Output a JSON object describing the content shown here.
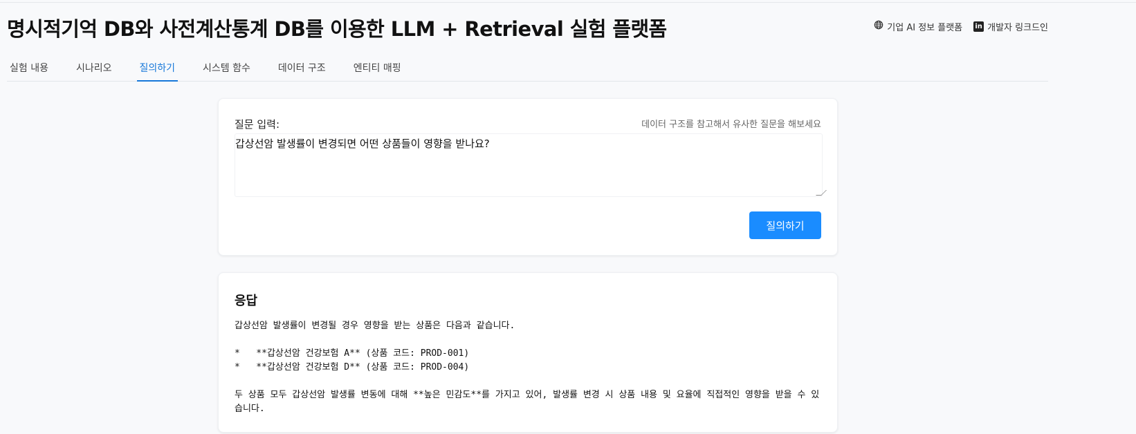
{
  "header": {
    "title": "명시적기억 DB와 사전계산통계 DB를 이용한 LLM + Retrieval 실험 플랫폼",
    "links": [
      {
        "label": "기업 AI 정보 플랫폼",
        "icon": "globe-icon"
      },
      {
        "label": "개발자 링크드인",
        "icon": "linkedin-icon"
      }
    ]
  },
  "tabs": [
    {
      "label": "실험 내용",
      "active": false
    },
    {
      "label": "시나리오",
      "active": false
    },
    {
      "label": "질의하기",
      "active": true
    },
    {
      "label": "시스템 함수",
      "active": false
    },
    {
      "label": "데이터 구조",
      "active": false
    },
    {
      "label": "엔티티 매핑",
      "active": false
    }
  ],
  "query": {
    "label": "질문 입력:",
    "hint": "데이터 구조를 참고해서 유사한 질문을 해보세요",
    "value": "갑상선암 발생률이 변경되면 어떤 상품들이 영향을 받나요?",
    "submit_label": "질의하기"
  },
  "answer": {
    "title": "응답",
    "intro": "갑상선암 발생률이 변경될 경우 영향을 받는 상품은 다음과 같습니다.",
    "items": [
      "*   **갑상선암 건강보험 A** (상품 코드: PROD-001)",
      "*   **갑상선암 건강보험 D** (상품 코드: PROD-004)"
    ],
    "conclusion": "두 상품 모두 갑상선암 발생률 변동에 대해 **높은 민감도**를 가지고 있어, 발생률 변경 시 상품 내용 및 요율에 직접적인 영향을 받을 수 있습니다."
  },
  "colors": {
    "accent": "#1a8cff",
    "active_tab": "#1677d9",
    "background": "#f8f9fb"
  }
}
